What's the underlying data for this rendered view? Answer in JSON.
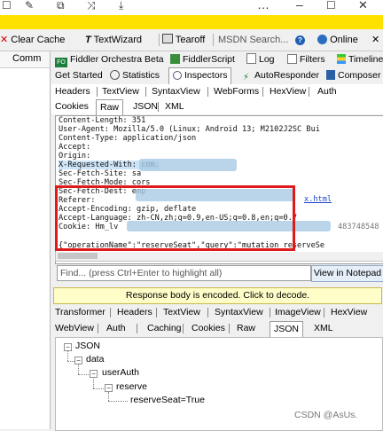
{
  "titlebar": {
    "icons": [
      "checkbox-icon",
      "edit-icon",
      "copy-icon",
      "shuffle-icon",
      "download-icon",
      "more-icon",
      "minimize-icon",
      "maximize-icon",
      "close-icon"
    ]
  },
  "toolbar": {
    "clear_cache": "Clear Cache",
    "textwizard": "TextWizard",
    "tearoff": "Tearoff",
    "msdn_search": "MSDN Search...",
    "online": "Online"
  },
  "left_pane": {
    "header": "Comm"
  },
  "top_tabs_row1": [
    "Fiddler Orchestra Beta",
    "FiddlerScript",
    "Log",
    "Filters",
    "Timeline"
  ],
  "top_tabs_row2": [
    "Get Started",
    "Statistics",
    "Inspectors",
    "AutoResponder",
    "Composer"
  ],
  "request_tabs_row1": [
    "Headers",
    "TextView",
    "SyntaxView",
    "WebForms",
    "HexView",
    "Auth"
  ],
  "request_tabs_row2": [
    "Cookies",
    "Raw",
    "JSON",
    "XML"
  ],
  "raw_lines": [
    "Content-Length: 351",
    "User-Agent: Mozilla/5.0 (Linux; Android 13; M2102J2SC Bui",
    "Content-Type: application/json",
    "Accept:",
    "Origin:",
    "X-Requested-With: com.",
    "Sec-Fetch-Site: sa",
    "Sec-Fetch-Mode: cors",
    "Sec-Fetch-Dest: emp",
    "Referer:",
    "Accept-Encoding: gzip, deflate",
    "Accept-Language: zh-CN,zh;q=0.9,en-US;q=0.8,en;q=0.7",
    "Cookie: Hm_lv",
    "",
    "{\"operationName\":\"reserveSeat\",\"query\":\"mutation reserveSe"
  ],
  "raw_fragments": {
    "html_link": "x.html",
    "cookie_tail": "483748548"
  },
  "find": {
    "placeholder": "Find... (press Ctrl+Enter to highlight all)",
    "view_notepad": "View in Notepad"
  },
  "response": {
    "encoded_notice": "Response body is encoded. Click to decode.",
    "tabs_row1": [
      "Transformer",
      "Headers",
      "TextView",
      "SyntaxView",
      "ImageView",
      "HexView"
    ],
    "tabs_row2": [
      "WebView",
      "Auth",
      "Caching",
      "Cookies",
      "Raw",
      "JSON",
      "XML"
    ],
    "active_tab": "JSON"
  },
  "tree": {
    "root": "JSON",
    "n1": "data",
    "n2": "userAuth",
    "n3": "reserve",
    "n4": "reserveSeat=True"
  },
  "watermark": "CSDN @AsUs."
}
